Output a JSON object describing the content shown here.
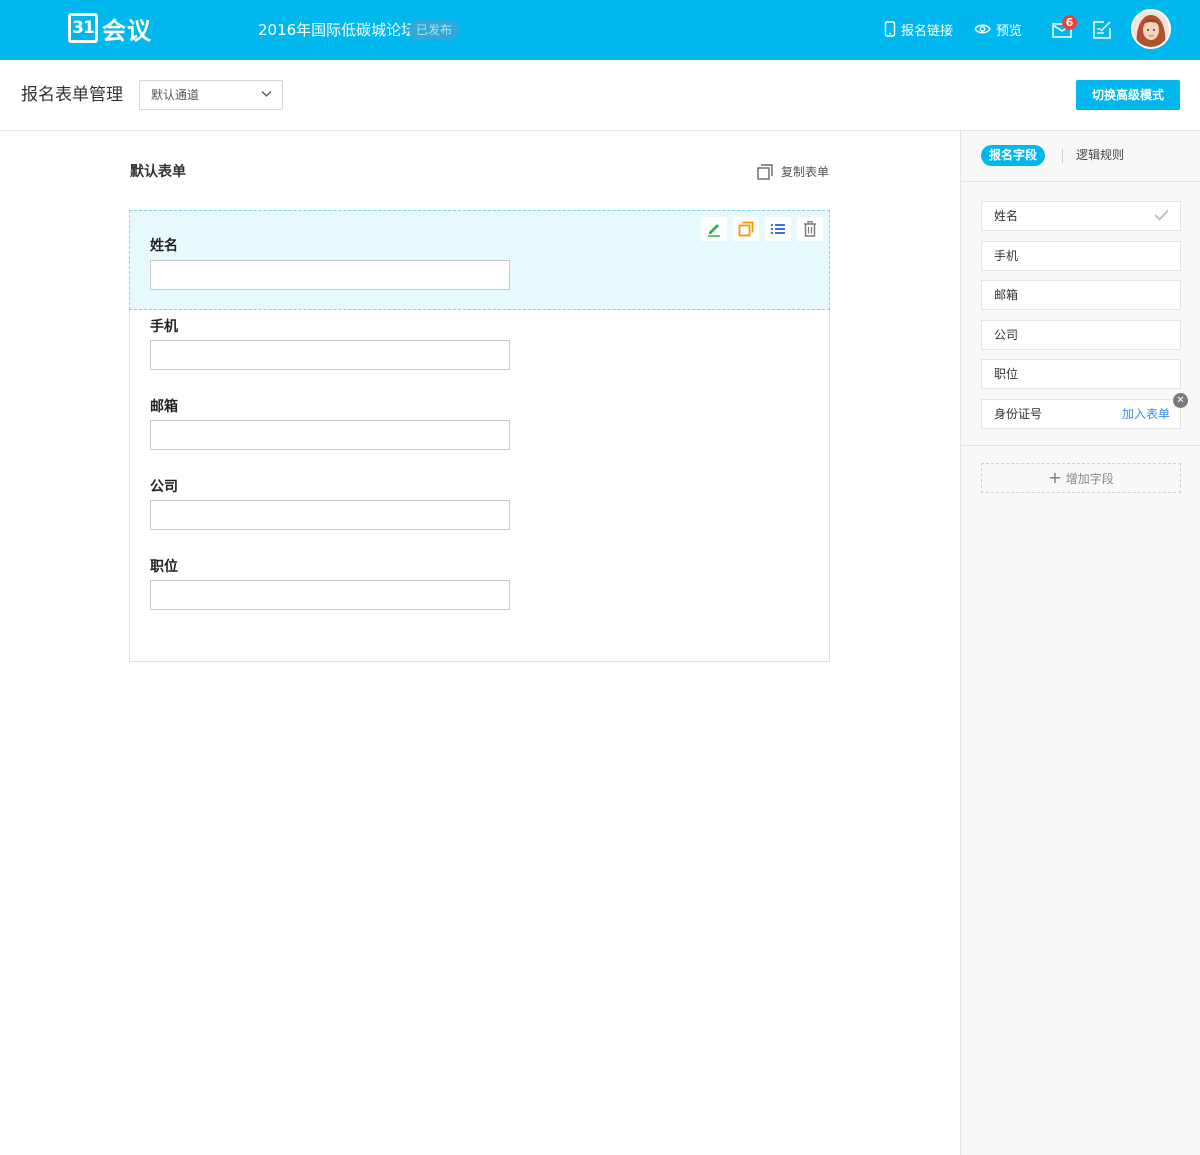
{
  "header": {
    "logo_number": "31",
    "logo_text": "会议",
    "event_title": "2016年国际低碳城论坛",
    "status": "已发布",
    "signup_link_label": "报名链接",
    "preview_label": "预览",
    "mail_badge": "6"
  },
  "subheader": {
    "page_title": "报名表单管理",
    "channel_selected": "默认通道",
    "advanced_mode_button": "切换高级模式"
  },
  "form": {
    "title": "默认表单",
    "copy_label": "复制表单",
    "fields": [
      {
        "label": "姓名",
        "value": ""
      },
      {
        "label": "手机",
        "value": ""
      },
      {
        "label": "邮箱",
        "value": ""
      },
      {
        "label": "公司",
        "value": ""
      },
      {
        "label": "职位",
        "value": ""
      }
    ]
  },
  "panel": {
    "tab_fields": "报名字段",
    "tab_rules": "逻辑规则",
    "available_fields": [
      {
        "label": "姓名",
        "checked": true
      },
      {
        "label": "手机"
      },
      {
        "label": "邮箱"
      },
      {
        "label": "公司"
      },
      {
        "label": "职位"
      },
      {
        "label": "身份证号",
        "action": "加入表单"
      }
    ],
    "add_field_label": "增加字段"
  },
  "colors": {
    "brand": "#00b7ee",
    "selected_bg": "#e8f9fd",
    "badge": "#f0403b",
    "link": "#3a8ee6"
  },
  "icons": [
    "phone-icon",
    "eye-icon",
    "mail-icon",
    "edit-note-icon",
    "chevron-down-icon",
    "copy-icon",
    "pencil-icon",
    "duplicate-icon",
    "list-icon",
    "trash-icon",
    "checkmark-icon",
    "close-icon",
    "plus-icon"
  ]
}
